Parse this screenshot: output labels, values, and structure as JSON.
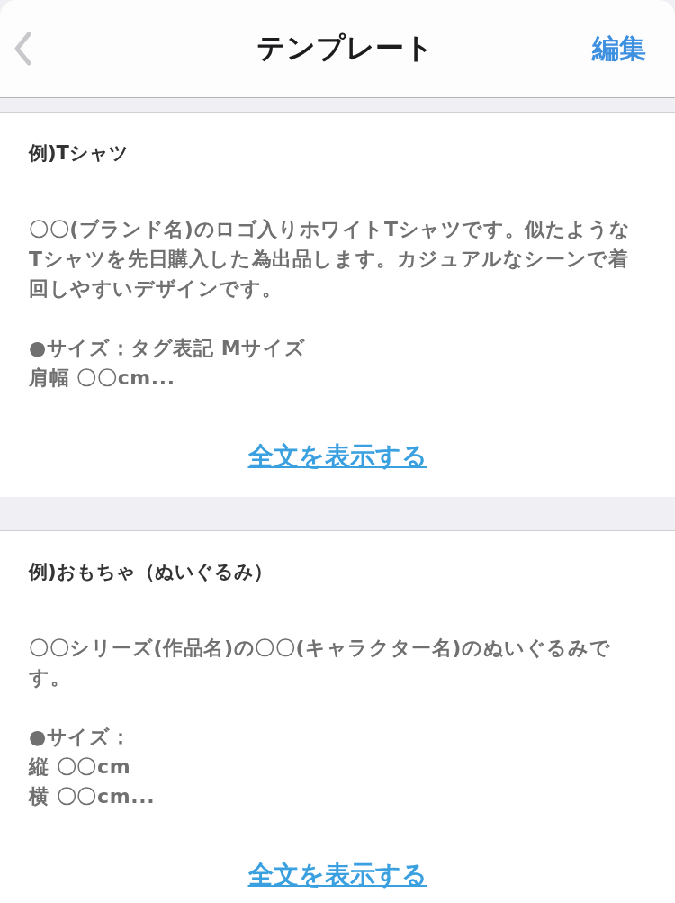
{
  "nav_bar": {
    "title": "テンプレート",
    "edit_label": "編集"
  },
  "templates": [
    {
      "title": "例)Tシャツ",
      "paragraphs": [
        [
          "〇〇(ブランド名)のロゴ入りホワイトTシャツです。似たようなTシャツを先日購入した為出品します。カジュアルなシーンで着回しやすいデザインです。"
        ],
        [
          "●サイズ：タグ表記 Mサイズ",
          "肩幅 〇〇cm..."
        ]
      ],
      "link": "全文を表示する"
    },
    {
      "title": "例)おもちゃ（ぬいぐるみ）",
      "paragraphs": [
        [
          "〇〇シリーズ(作品名)の〇〇(キャラクター名)のぬいぐるみです。"
        ],
        [
          "●サイズ：",
          "縦 〇〇cm",
          "横 〇〇cm..."
        ]
      ],
      "link": "全文を表示する"
    }
  ]
}
